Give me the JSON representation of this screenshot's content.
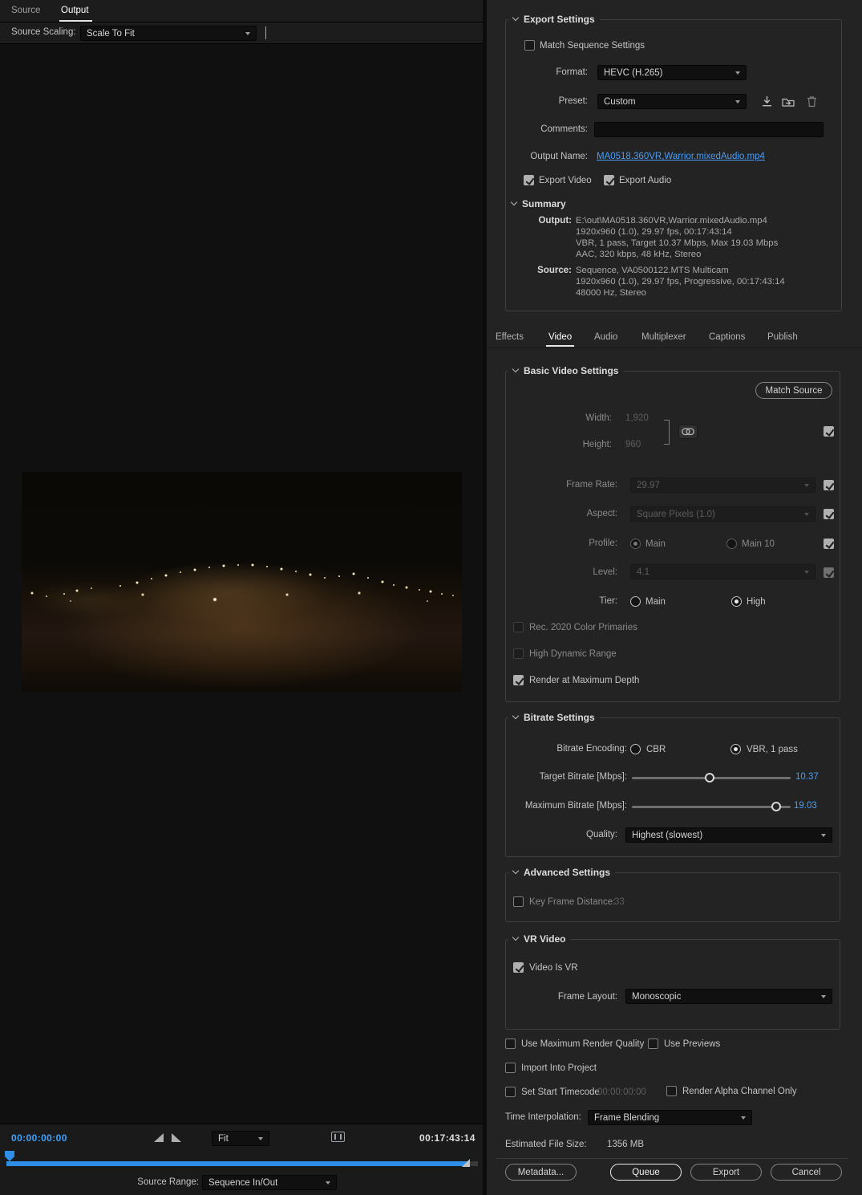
{
  "colors": {
    "accent_blue": "#2f8fe8",
    "link_blue": "#4a9df5",
    "value_blue": "#3fa2ff",
    "panel_bg": "#232323",
    "preview_bg": "#101010"
  },
  "icons": {
    "section_chevron": "chevron-down",
    "dropdown_arrow": "triangle-down",
    "preset_save": "download-arrow",
    "preset_import": "import-arrow",
    "preset_delete": "trash",
    "dimension_link": "chain-link",
    "set_in_point": "triangle-in",
    "set_out_point": "triangle-out",
    "work_area": "range-rect",
    "playhead": "playhead-marker"
  },
  "left": {
    "tabs": [
      {
        "label": "Source"
      },
      {
        "label": "Output"
      }
    ],
    "source_scaling": {
      "label": "Source Scaling:",
      "value": "Scale To Fit"
    },
    "transport": {
      "current": "00:00:00:00",
      "fit": "Fit",
      "duration": "00:17:43:14"
    },
    "source_range": {
      "label": "Source Range:",
      "value": "Sequence In/Out"
    }
  },
  "export": {
    "title": "Export Settings",
    "match_sequence": "Match Sequence Settings",
    "format": {
      "label": "Format:",
      "value": "HEVC (H.265)"
    },
    "preset": {
      "label": "Preset:",
      "value": "Custom"
    },
    "comments": {
      "label": "Comments:"
    },
    "output_name": {
      "label": "Output Name:",
      "value": "MA0518.360VR,Warrior.mixedAudio.mp4"
    },
    "export_video": "Export Video",
    "export_audio": "Export Audio",
    "summary": {
      "title": "Summary",
      "output_label": "Output:",
      "output_lines": [
        "E:\\out\\MA0518.360VR,Warrior.mixedAudio.mp4",
        "1920x960 (1.0), 29.97 fps, 00:17:43:14",
        "VBR, 1 pass, Target 10.37 Mbps, Max 19.03 Mbps",
        "AAC, 320 kbps, 48 kHz, Stereo"
      ],
      "source_label": "Source:",
      "source_lines": [
        "Sequence, VA0500122.MTS Multicam",
        "1920x960 (1.0), 29.97 fps, Progressive, 00:17:43:14",
        "48000 Hz, Stereo"
      ]
    }
  },
  "tabs": {
    "items": [
      {
        "label": "Effects"
      },
      {
        "label": "Video"
      },
      {
        "label": "Audio"
      },
      {
        "label": "Multiplexer"
      },
      {
        "label": "Captions"
      },
      {
        "label": "Publish"
      }
    ]
  },
  "basic_video": {
    "title": "Basic Video Settings",
    "match_source": "Match Source",
    "width": {
      "label": "Width:",
      "value": "1,920"
    },
    "height": {
      "label": "Height:",
      "value": "960"
    },
    "frame_rate": {
      "label": "Frame Rate:",
      "value": "29.97"
    },
    "aspect": {
      "label": "Aspect:",
      "value": "Square Pixels (1.0)"
    },
    "profile": {
      "label": "Profile:",
      "options": [
        "Main",
        "Main 10"
      ]
    },
    "level": {
      "label": "Level:",
      "value": "4.1"
    },
    "tier": {
      "label": "Tier:",
      "options": [
        "Main",
        "High"
      ]
    },
    "rec2020": "Rec. 2020 Color Primaries",
    "hdr": "High Dynamic Range",
    "max_depth": "Render at Maximum Depth"
  },
  "bitrate": {
    "title": "Bitrate Settings",
    "encoding_label": "Bitrate Encoding:",
    "cbr": "CBR",
    "vbr": "VBR, 1 pass",
    "target": {
      "label": "Target Bitrate [Mbps]:",
      "value": "10.37"
    },
    "maximum": {
      "label": "Maximum Bitrate [Mbps]:",
      "value": "19.03"
    },
    "quality": {
      "label": "Quality:",
      "value": "Highest (slowest)"
    }
  },
  "advanced": {
    "title": "Advanced Settings",
    "keyframe": {
      "label": "Key Frame Distance:",
      "value": "33"
    }
  },
  "vr": {
    "title": "VR Video",
    "video_is_vr": "Video Is VR",
    "frame_layout": {
      "label": "Frame Layout:",
      "value": "Monoscopic"
    }
  },
  "footer": {
    "use_max_quality": "Use Maximum Render Quality",
    "use_previews": "Use Previews",
    "import_into_project": "Import Into Project",
    "set_start_timecode": "Set Start Timecode",
    "start_timecode_value": "00:00:00:00",
    "render_alpha": "Render Alpha Channel Only",
    "time_interpolation": {
      "label": "Time Interpolation:",
      "value": "Frame Blending"
    },
    "estimated": {
      "label": "Estimated File Size:",
      "value": "1356 MB"
    },
    "buttons": {
      "metadata": "Metadata...",
      "queue": "Queue",
      "export": "Export",
      "cancel": "Cancel"
    }
  }
}
